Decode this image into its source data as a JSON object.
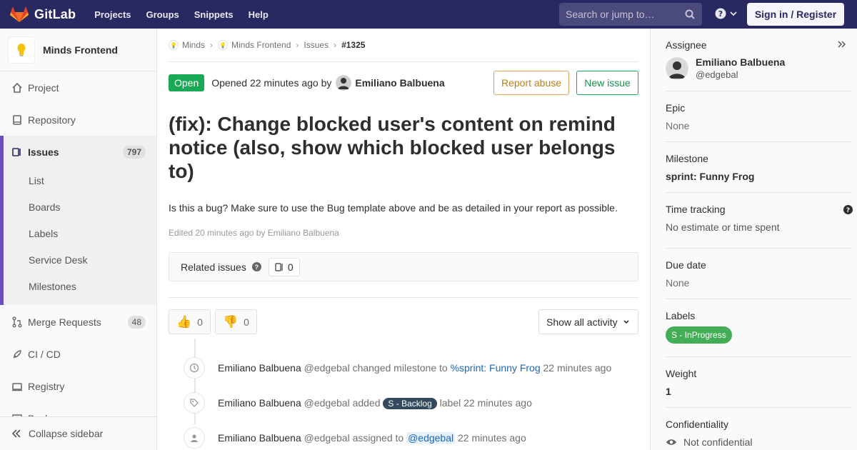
{
  "navbar": {
    "brand": "GitLab",
    "links": [
      "Projects",
      "Groups",
      "Snippets",
      "Help"
    ],
    "search_placeholder": "Search or jump to…",
    "signin_label": "Sign in / Register",
    "accent": "#292961"
  },
  "sidebar": {
    "project_name": "Minds Frontend",
    "items": {
      "project": "Project",
      "repository": "Repository",
      "issues": "Issues",
      "issues_count": "797",
      "merge_requests": "Merge Requests",
      "merge_requests_count": "48",
      "ci_cd": "CI / CD",
      "registry": "Registry",
      "partial": "Packages"
    },
    "issues_sub": [
      "List",
      "Boards",
      "Labels",
      "Service Desk",
      "Milestones"
    ],
    "collapse_label": "Collapse sidebar"
  },
  "breadcrumb": {
    "group": "Minds",
    "project": "Minds Frontend",
    "section": "Issues",
    "current": "#1325"
  },
  "issue": {
    "status": "Open",
    "opened_text": "Opened 22 minutes ago by",
    "author": "Emiliano Balbuena",
    "report_label": "Report abuse",
    "new_issue_label": "New issue",
    "title": "(fix): Change blocked user's content on remind notice (also, show which blocked user belongs to)",
    "description": "Is this a bug? Make sure to use the Bug template above and be as detailed in your report as possible.",
    "edited": "Edited 20 minutes ago by Emiliano Balbuena",
    "related_title": "Related issues",
    "related_count": "0",
    "thumbs_up": "0",
    "thumbs_down": "0",
    "activity_filter": "Show all activity"
  },
  "timeline": [
    {
      "author": "Emiliano Balbuena",
      "handle": "@edgebal",
      "action": "changed milestone to",
      "target": "%sprint: Funny Frog",
      "time": "22 minutes ago"
    },
    {
      "author": "Emiliano Balbuena",
      "handle": "@edgebal",
      "action": "added",
      "target": "S - Backlog",
      "suffix": "label",
      "time": "22 minutes ago"
    },
    {
      "author": "Emiliano Balbuena",
      "handle": "@edgebal",
      "action": "assigned to",
      "target": "@edgebal",
      "time": "22 minutes ago"
    }
  ],
  "right_sidebar": {
    "assignee_title": "Assignee",
    "assignee_name": "Emiliano Balbuena",
    "assignee_handle": "@edgebal",
    "epic_title": "Epic",
    "epic_value": "None",
    "milestone_title": "Milestone",
    "milestone_value": "sprint: Funny Frog",
    "time_title": "Time tracking",
    "time_value": "No estimate or time spent",
    "due_title": "Due date",
    "due_value": "None",
    "labels_title": "Labels",
    "label_value": "S - InProgress",
    "label_color": "#44ad58",
    "weight_title": "Weight",
    "weight_value": "1",
    "confidentiality_title": "Confidentiality",
    "confidentiality_value": "Not confidential"
  }
}
